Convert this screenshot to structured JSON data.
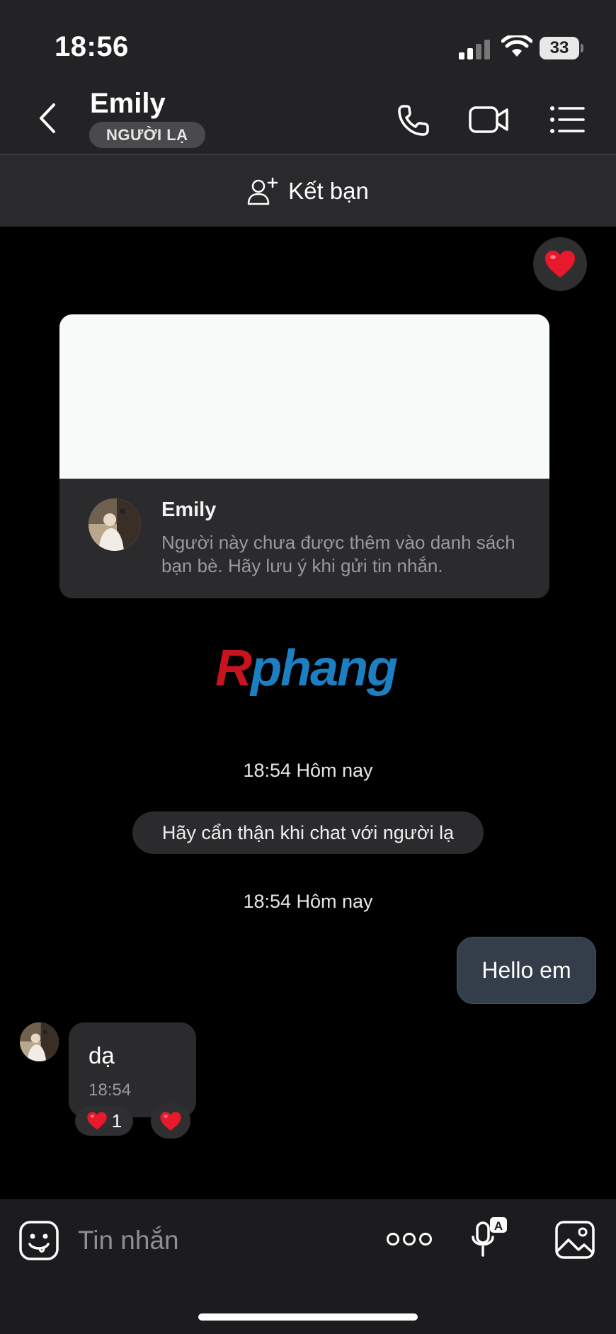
{
  "status_bar": {
    "time": "18:56",
    "battery": "33",
    "icons": [
      "signal-icon",
      "wifi-icon",
      "battery-icon"
    ]
  },
  "header": {
    "name": "Emily",
    "badge": "NGƯỜI LẠ",
    "icons": [
      "back-icon",
      "phone-icon",
      "video-camera-icon",
      "list-menu-icon"
    ]
  },
  "add_friend": {
    "label": "Kết bạn",
    "icon": "add-user-icon"
  },
  "profile_card": {
    "name": "Emily",
    "note": "Người này chưa được thêm vào danh sách bạn bè. Hãy lưu ý khi gửi tin nhắn."
  },
  "watermark": {
    "first": "R",
    "rest": "phang"
  },
  "messages": {
    "timestamp_1": "18:54 Hôm nay",
    "warning": "Hãy cẩn thận khi chat với người lạ",
    "timestamp_2": "18:54 Hôm nay",
    "outgoing": "Hello em",
    "incoming_text": "dạ",
    "incoming_time": "18:54",
    "reaction_count": "1"
  },
  "input": {
    "placeholder": "Tin nhắn",
    "icons": [
      "emoji-icon",
      "more-icon",
      "voice-to-text-icon",
      "image-icon"
    ]
  },
  "colors": {
    "background": "#000000",
    "header": "#232325",
    "bubble_outgoing": "#343d4a",
    "bubble_incoming": "#2b2b2d",
    "heart": "#e8192c"
  }
}
